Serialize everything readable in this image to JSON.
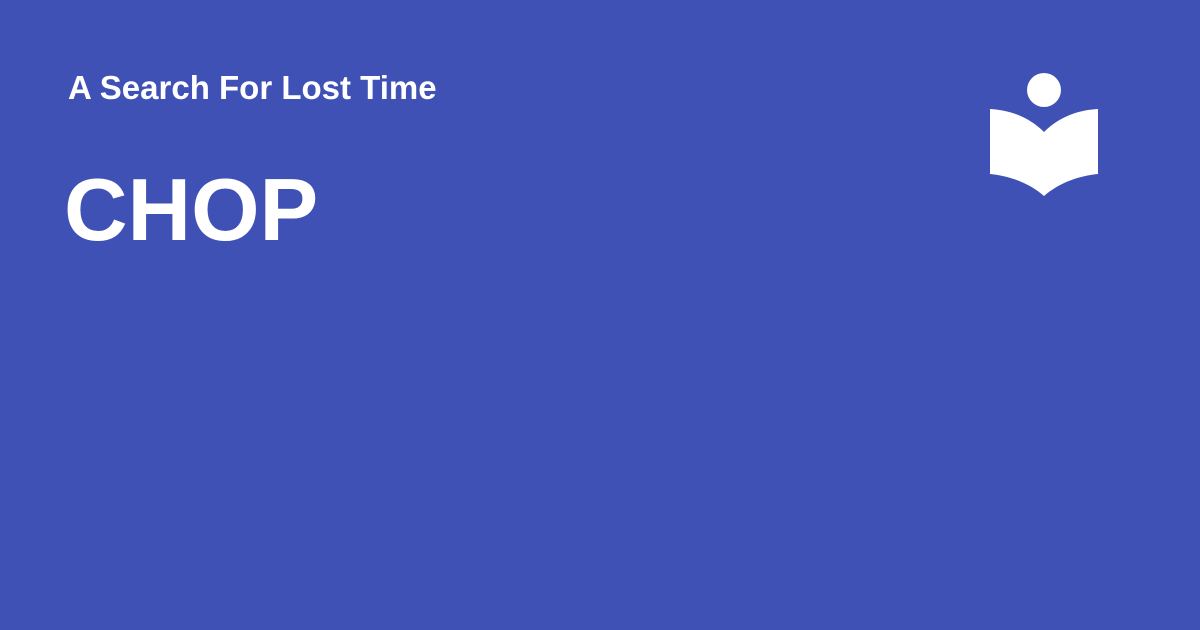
{
  "card": {
    "background_color": "#3f51b5",
    "text_color": "#ffffff",
    "subtitle": "A Search For Lost Time",
    "title": "CHOP",
    "logo_icon": "reader-book-icon"
  }
}
